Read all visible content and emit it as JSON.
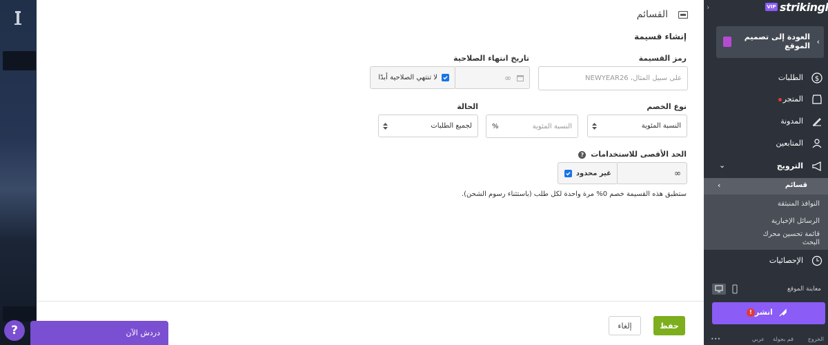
{
  "modal": {
    "title": "القسائم",
    "subtitle": "إنشاء قسيمة",
    "coupon_code": {
      "label": "رمز القسيمة",
      "placeholder": "على سبيل المثال، NEWYEAR26"
    },
    "expiry": {
      "label": "تاريخ انتهاء الصلاحية",
      "value": "∞",
      "checkbox_label": "لا تنتهي الصلاحية أبدًا"
    },
    "discount_type": {
      "label": "نوع الخصم",
      "selected": "النسبة المئوية"
    },
    "discount_value": {
      "placeholder": "النسبة المئوية",
      "unit": "%"
    },
    "status": {
      "label": "الحالة",
      "selected": "لجميع الطلبات"
    },
    "max_uses": {
      "label": "الحد الأقصى للاستخدامات",
      "help_icon": "?",
      "value": "∞",
      "checkbox_label": "غير محدود"
    },
    "summary": "ستطبق هذه القسيمة خصم 0% مرة واحدة لكل طلب (باستثناء رسوم الشحن).",
    "save_label": "حفظ",
    "cancel_label": "إلغاء"
  },
  "sidebar": {
    "brand": "strikingly",
    "badge": "VIP",
    "back_label": "العودة إلى تصميم الموقع",
    "items": {
      "orders": "الطلبات",
      "store": "المتجر",
      "blog": "المدونة",
      "followers": "المتابعين",
      "promotion": "الترويج",
      "analytics": "الإحصائيات"
    },
    "promo_sub": {
      "coupons": "قسائم",
      "popups": "النوافذ المنبثقة",
      "newsletters": "الرسائل الإخبارية",
      "seo": "قائمة تحسين محرك البحث"
    },
    "preview_label": "معاينة الموقع",
    "publish_label": "انشر",
    "footer": {
      "exit": "الخروج",
      "tour": "قم بجولة",
      "lang": "عربي",
      "more": "•••"
    }
  },
  "chat": {
    "label": "دردش الآن",
    "help": "?"
  },
  "colors": {
    "accent": "#8b5cf6",
    "save": "#7cae1d",
    "checkbox": "#1a73e8",
    "sidebar": "#2d323a"
  }
}
